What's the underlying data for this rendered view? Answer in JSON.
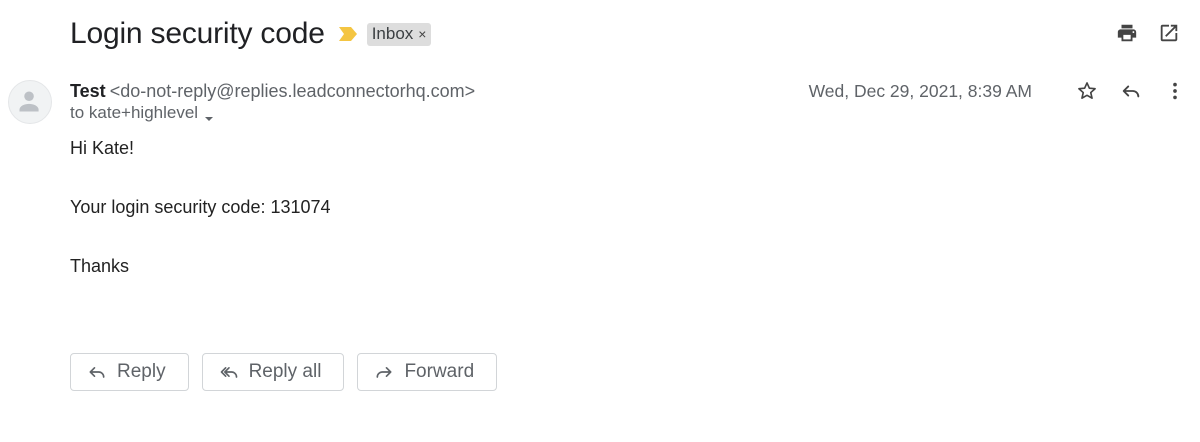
{
  "email": {
    "subject": "Login security code",
    "label": "Inbox",
    "label_remove": "×",
    "sender_name": "Test",
    "sender_email": "<do-not-reply@replies.leadconnectorhq.com>",
    "recipient": "to kate+highlevel",
    "date": "Wed, Dec 29, 2021, 8:39 AM",
    "body": {
      "greeting": "Hi Kate!",
      "code_line": "Your login security code: 131074",
      "signoff": "Thanks"
    }
  },
  "actions": {
    "reply": "Reply",
    "reply_all": "Reply all",
    "forward": "Forward"
  },
  "icons": {
    "importance": "importance-marker-icon",
    "print": "print-icon",
    "open_new_window": "open-in-new-window-icon",
    "star": "star-icon",
    "reply": "reply-icon",
    "more": "more-vert-icon",
    "avatar": "default-avatar-icon"
  },
  "colors": {
    "importance": "#f4c542",
    "label_bg": "#dddddd",
    "text_primary": "#202124",
    "text_secondary": "#5f6368"
  }
}
